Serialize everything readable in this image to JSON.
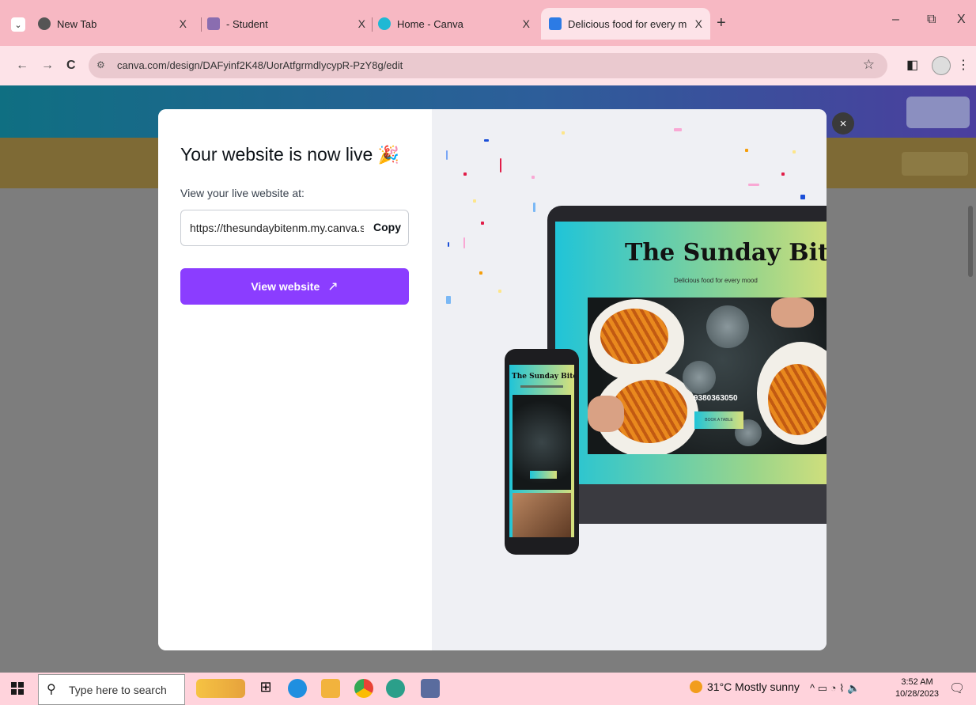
{
  "browser": {
    "tabs": [
      {
        "title": "New Tab",
        "close": "X"
      },
      {
        "title": "- Student",
        "close": "X"
      },
      {
        "title": "Home - Canva",
        "close": "X"
      },
      {
        "title": "Delicious food for every mood",
        "close": "X",
        "active": true
      }
    ],
    "new_tab": "+",
    "window_controls": {
      "minimize": "–",
      "restore": "⧉",
      "close": "X"
    },
    "url": "canva.com/design/DAFyinf2K48/UorAtfgrmdlycypR-PzY8g/edit"
  },
  "modal": {
    "title": "Your website is now live",
    "title_icon": "party-popper-icon",
    "view_label": "View your live website at:",
    "site_url": "https://thesundaybitenm.my.canva.si",
    "copy_label": "Copy",
    "view_button": "View website",
    "close": "×"
  },
  "preview": {
    "site_title": "The Sunday Bite",
    "tagline": "Delicious food for every mood",
    "phone_number": "9380363050",
    "book_button": "BOOK A TABLE",
    "phone_title": "The Sunday Bite"
  },
  "taskbar": {
    "search_placeholder": "Type here to search",
    "weather": "31°C  Mostly sunny",
    "time": "3:52 AM",
    "date": "10/28/2023"
  },
  "colors": {
    "accent": "#8b3dff",
    "tabstrip": "#f7b8c3",
    "toolbar": "#fde3e8"
  }
}
